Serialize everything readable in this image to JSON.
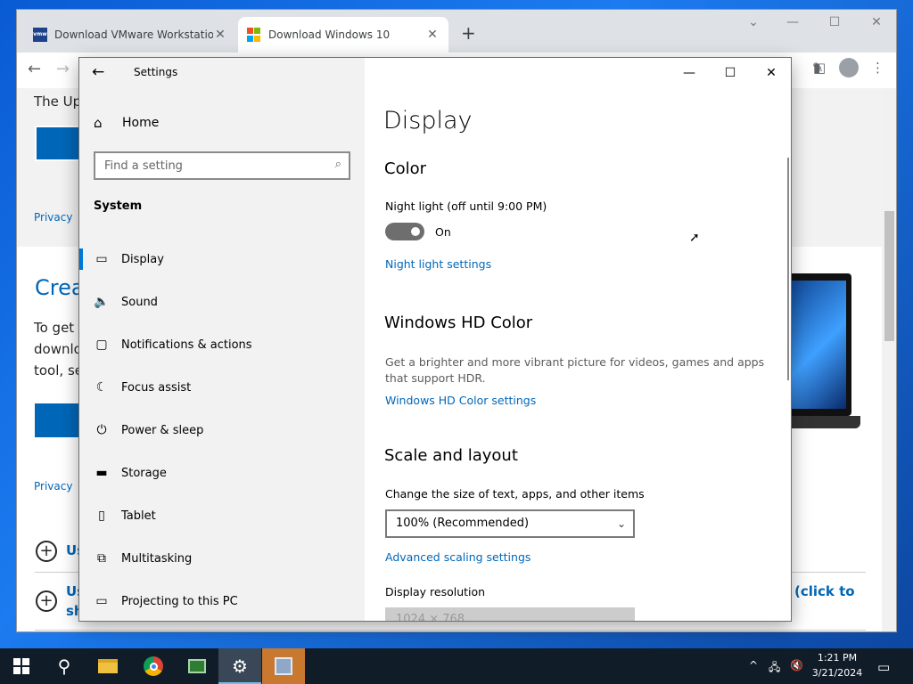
{
  "browser": {
    "tabs": [
      {
        "title": "Download VMware Workstation",
        "close": "✕"
      },
      {
        "title": "Download Windows 10",
        "close": "✕"
      }
    ],
    "new_tab": "+",
    "window_controls": {
      "dropdown": "⌄",
      "minimize": "—",
      "maximize": "☐",
      "close": "✕"
    },
    "page": {
      "text_top": "The Up",
      "privacy_1": "Privacy",
      "heading_create": "Crea",
      "para_1": "To get s",
      "para_2": "downlo",
      "para_3": "tool, se",
      "privacy_2": "Privacy",
      "accordion_1": "Us",
      "accordion_2a": "Us",
      "accordion_2b": "sh",
      "click_to": "(click to"
    }
  },
  "settings": {
    "app_title": "Settings",
    "window_controls": {
      "minimize": "—",
      "maximize": "☐",
      "close": "✕"
    },
    "home_label": "Home",
    "search_placeholder": "Find a setting",
    "section_label": "System",
    "nav_items": [
      {
        "label": "Display",
        "icon": "monitor-icon",
        "glyph": "▭",
        "selected": true
      },
      {
        "label": "Sound",
        "icon": "speaker-icon",
        "glyph": "🔈",
        "selected": false
      },
      {
        "label": "Notifications & actions",
        "icon": "notification-icon",
        "glyph": "▢",
        "selected": false
      },
      {
        "label": "Focus assist",
        "icon": "moon-icon",
        "glyph": "☾",
        "selected": false
      },
      {
        "label": "Power & sleep",
        "icon": "power-icon",
        "glyph": "⏻",
        "selected": false
      },
      {
        "label": "Storage",
        "icon": "storage-icon",
        "glyph": "▬",
        "selected": false
      },
      {
        "label": "Tablet",
        "icon": "tablet-icon",
        "glyph": "▯",
        "selected": false
      },
      {
        "label": "Multitasking",
        "icon": "multitasking-icon",
        "glyph": "⧉",
        "selected": false
      },
      {
        "label": "Projecting to this PC",
        "icon": "projecting-icon",
        "glyph": "▭",
        "selected": false
      }
    ],
    "content": {
      "page_title": "Display",
      "color_heading": "Color",
      "night_light_label": "Night light (off until 9:00 PM)",
      "toggle_state": "On",
      "night_light_link": "Night light settings",
      "hd_color_heading": "Windows HD Color",
      "hd_color_desc": "Get a brighter and more vibrant picture for videos, games and apps that support HDR.",
      "hd_color_link": "Windows HD Color settings",
      "scale_heading": "Scale and layout",
      "scale_label": "Change the size of text, apps, and other items",
      "scale_value": "100% (Recommended)",
      "advanced_scaling_link": "Advanced scaling settings",
      "resolution_label": "Display resolution",
      "resolution_value": "1024 × 768"
    }
  },
  "taskbar": {
    "time": "1:21 PM",
    "date": "3/21/2024",
    "tray_chevron": "^"
  },
  "colors": {
    "accent": "#0078d7",
    "link": "#0067b8",
    "taskbar": "#101c28"
  }
}
